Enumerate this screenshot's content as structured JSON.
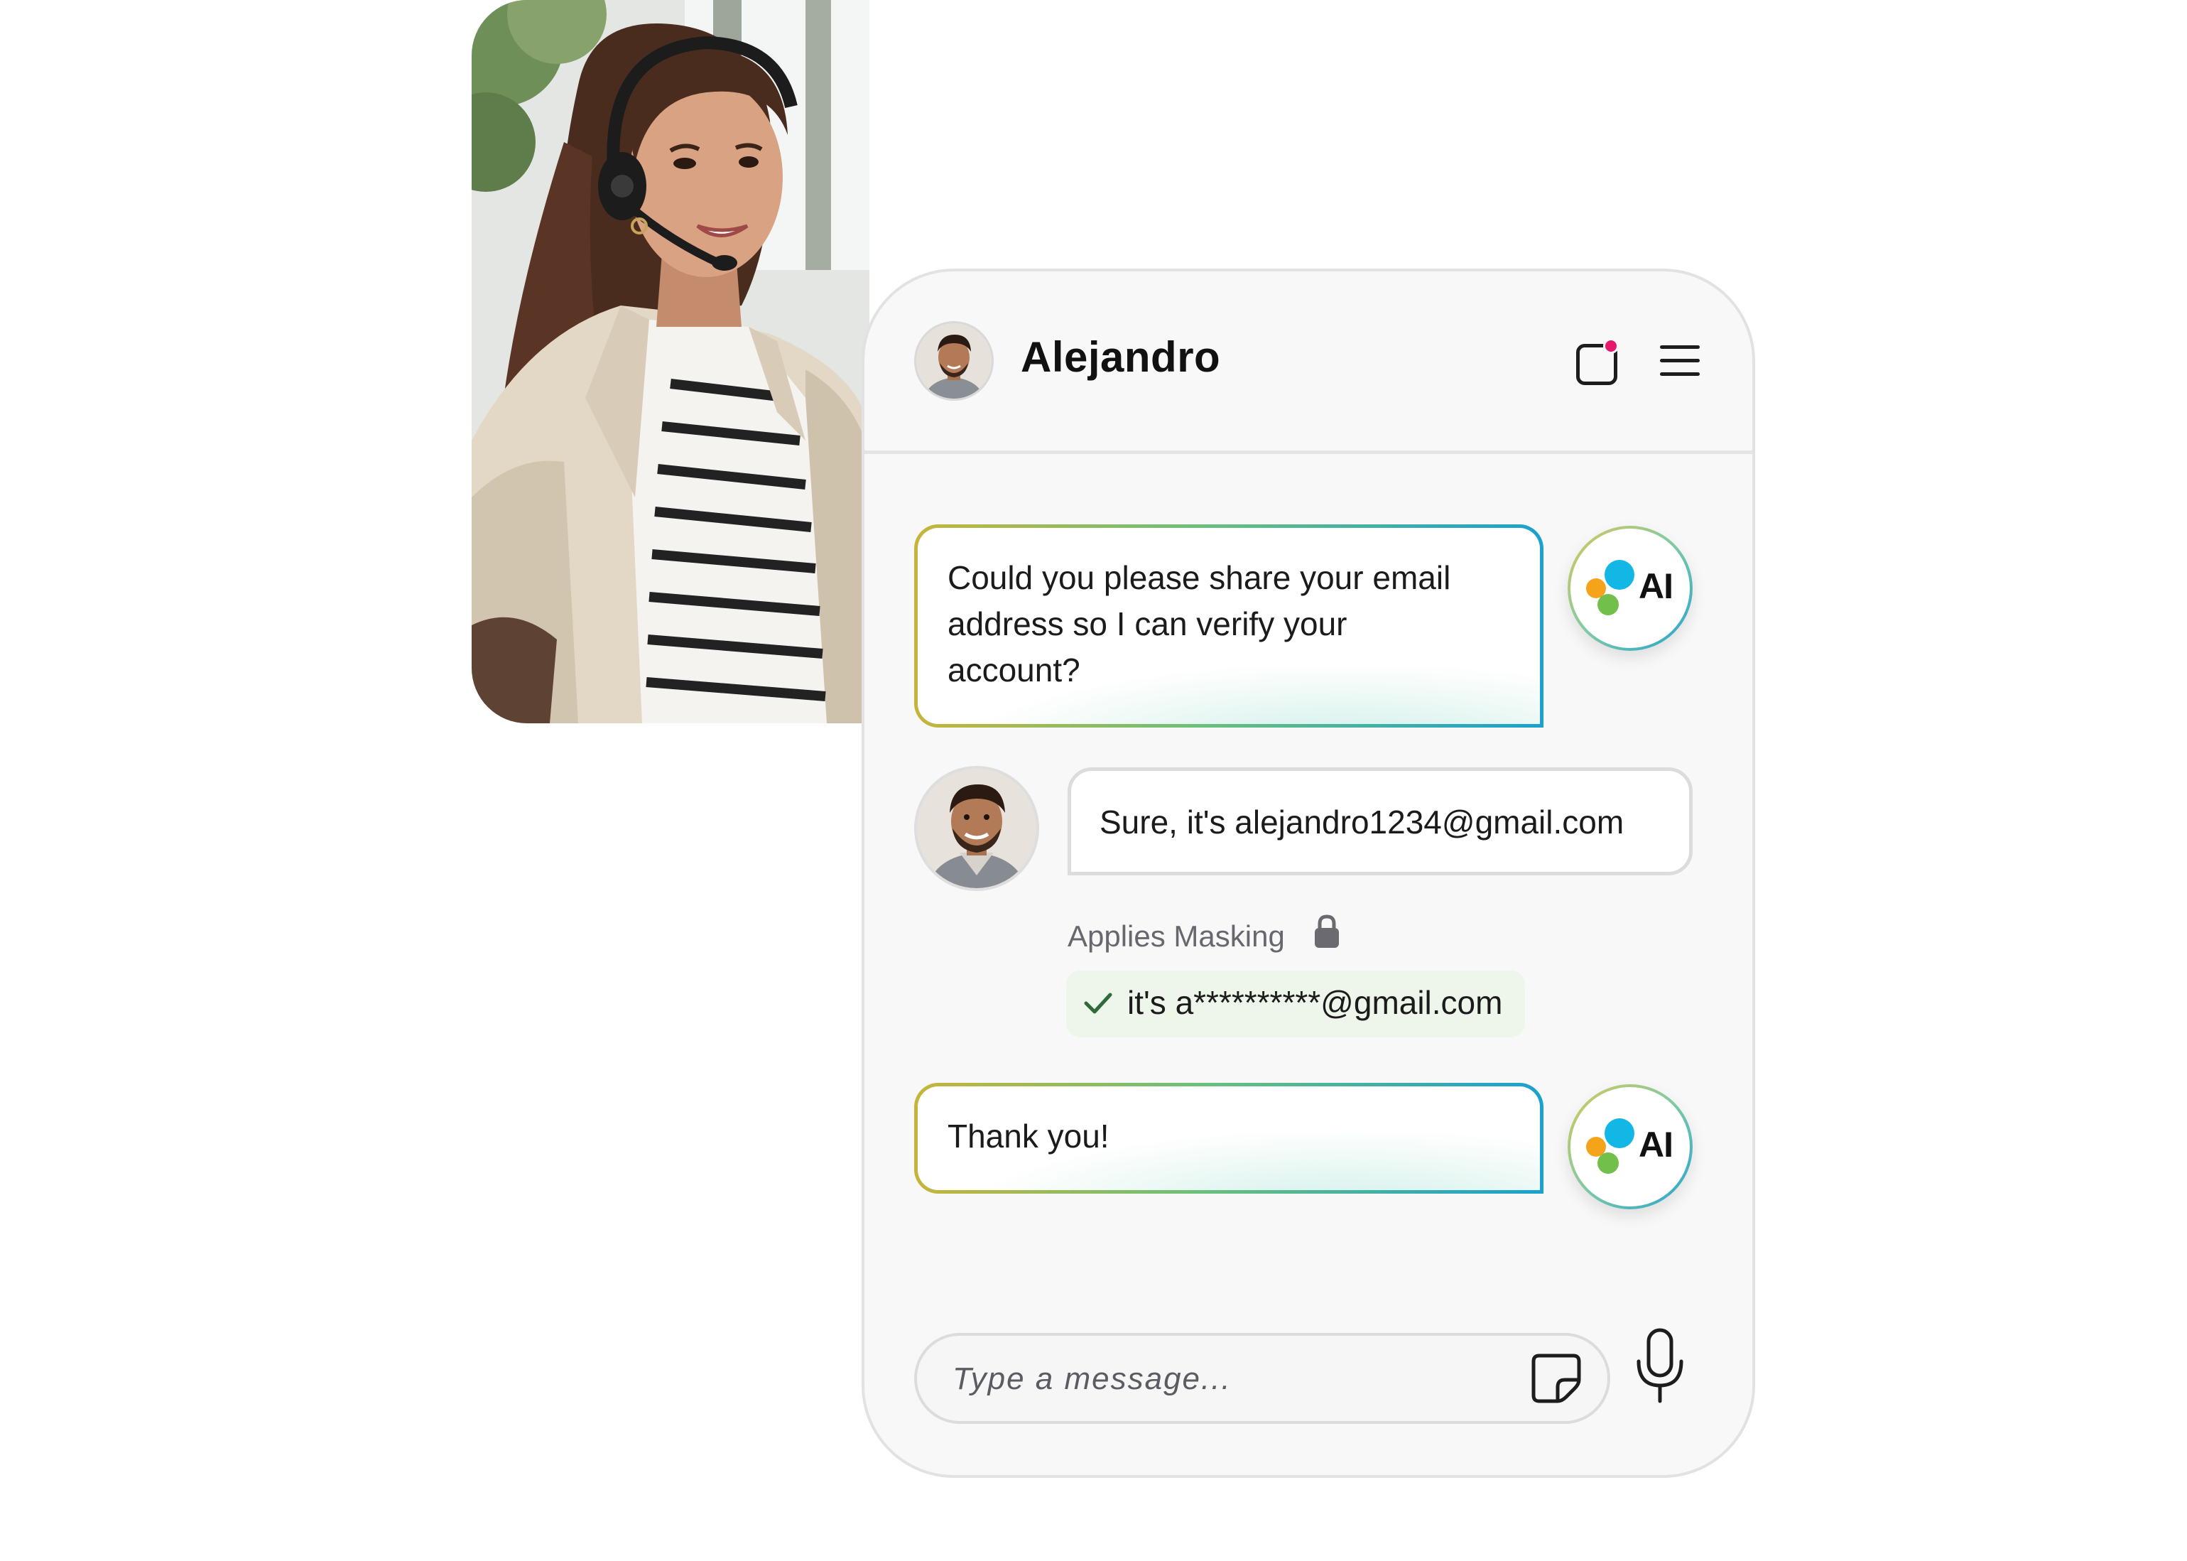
{
  "agent_photo": {
    "description_icon": "customer-service-agent-photo"
  },
  "chat": {
    "header": {
      "contact_name": "Alejandro",
      "notification_icon": "notification-square-icon",
      "menu_icon": "hamburger-menu-icon"
    },
    "messages": [
      {
        "sender": "ai",
        "text_lines": [
          "Could you please share your email",
          "address so I can verify your",
          "account?"
        ],
        "avatar_label": "AI"
      },
      {
        "sender": "user",
        "text": "Sure, it's alejandro1234@gmail.com"
      },
      {
        "sender": "ai",
        "text_lines": [
          "Thank you!"
        ],
        "avatar_label": "AI"
      }
    ],
    "masking": {
      "label": "Applies Masking",
      "masked_text": "it's a**********@gmail.com"
    },
    "input": {
      "placeholder": "Type a message...",
      "sticker_icon": "sticker-icon",
      "mic_icon": "microphone-icon"
    }
  },
  "colors": {
    "ai_gradient_start": "#c5b53a",
    "ai_gradient_mid": "#6cc07a",
    "ai_gradient_end": "#1aa1cf",
    "notification_dot": "#e5186e",
    "ai_dot_orange": "#f6a31c",
    "ai_dot_blue": "#12b7e6",
    "ai_dot_green": "#72c04b",
    "masked_pill_bg": "#eef5ea",
    "check_green": "#2f6b3a"
  }
}
